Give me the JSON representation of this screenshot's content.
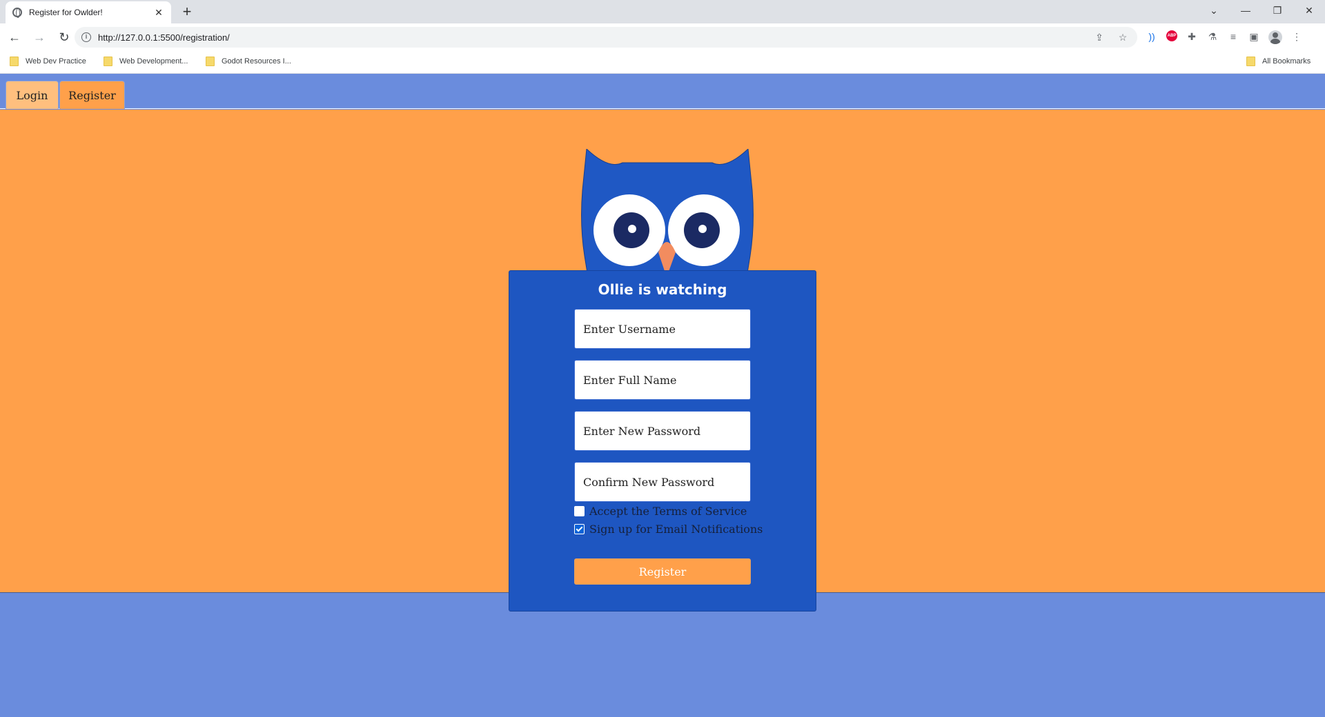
{
  "browser": {
    "tab_title": "Register for Owlder!",
    "url": "http://127.0.0.1:5500/registration/",
    "bookmarks": [
      "Web Dev Practice",
      "Web Development...",
      "Godot Resources I..."
    ],
    "all_bookmarks_label": "All Bookmarks",
    "abp_label": "ABP"
  },
  "nav": {
    "tabs": [
      {
        "label": "Login"
      },
      {
        "label": "Register"
      }
    ],
    "active_tab": "Register"
  },
  "card": {
    "title": "Ollie is watching",
    "fields": {
      "username_placeholder": "Enter Username",
      "fullname_placeholder": "Enter Full Name",
      "password_placeholder": "Enter New Password",
      "confirm_placeholder": "Confirm New Password"
    },
    "checkboxes": [
      {
        "label": "Accept the Terms of Service",
        "checked": false
      },
      {
        "label": "Sign up for Email Notifications",
        "checked": true
      }
    ],
    "submit_label": "Register"
  },
  "colors": {
    "page_blue": "#6a8cdd",
    "hero_orange": "#ffa04a",
    "card_blue": "#1e56c1",
    "owl_blue": "#1f58c4",
    "owl_pupil": "#1b2a63",
    "beak": "#f28c5f"
  }
}
